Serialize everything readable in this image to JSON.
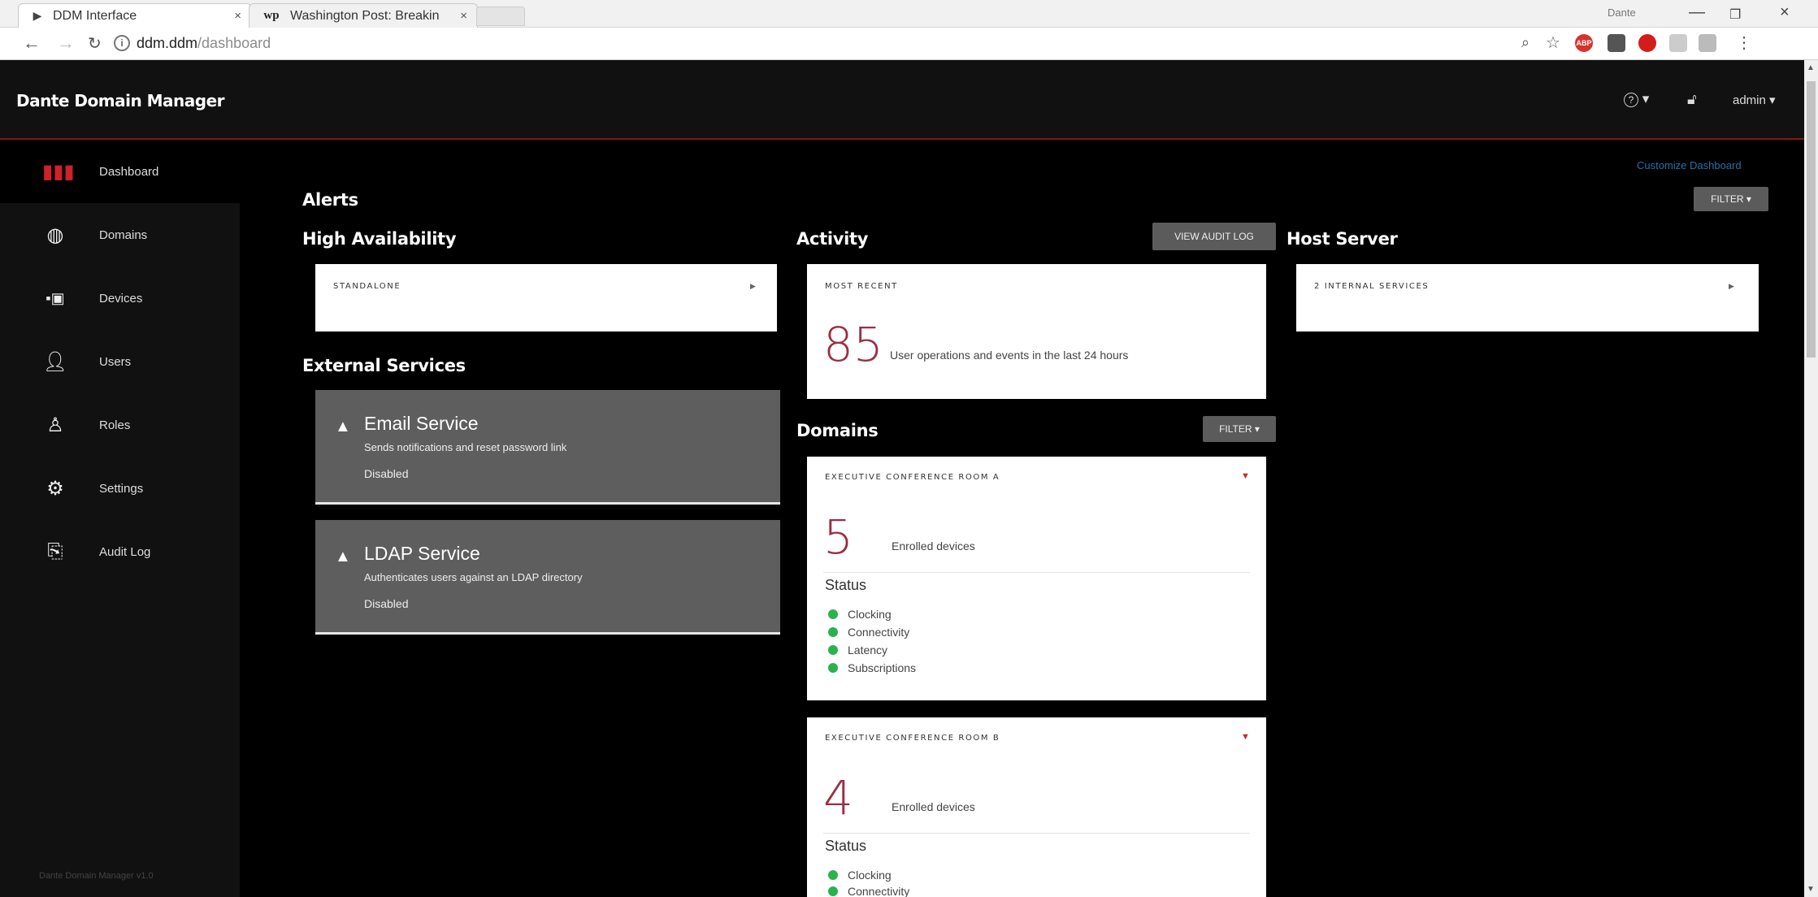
{
  "browser": {
    "tabs": [
      {
        "title": "DDM Interface",
        "favicon": "play-icon"
      },
      {
        "title": "Washington Post: Breakin",
        "favicon": "wp"
      }
    ],
    "profile": "Dante",
    "url_host": "ddm.ddm",
    "url_path": "/dashboard",
    "extensions": [
      "ABP"
    ]
  },
  "header": {
    "brand": "Dante Domain Manager",
    "help_label": "?",
    "user_label": "admin"
  },
  "sidebar": {
    "items": [
      {
        "label": "Dashboard",
        "icon": "bar-chart-icon"
      },
      {
        "label": "Domains",
        "icon": "globe-icon"
      },
      {
        "label": "Devices",
        "icon": "devices-icon"
      },
      {
        "label": "Users",
        "icon": "user-icon"
      },
      {
        "label": "Roles",
        "icon": "role-icon"
      },
      {
        "label": "Settings",
        "icon": "gears-icon"
      },
      {
        "label": "Audit Log",
        "icon": "audit-log-icon"
      }
    ],
    "version": "Dante Domain Manager v1.0"
  },
  "dashboard": {
    "customize_label": "Customize Dashboard",
    "filter_label": "FILTER",
    "alerts_title": "Alerts",
    "high_availability": {
      "title": "High Availability",
      "mode": "STANDALONE"
    },
    "external_services": {
      "title": "External Services",
      "services": [
        {
          "name": "Email Service",
          "description": "Sends notifications and reset password link",
          "state": "Disabled"
        },
        {
          "name": "LDAP Service",
          "description": "Authenticates users against an LDAP directory",
          "state": "Disabled"
        }
      ]
    },
    "activity": {
      "title": "Activity",
      "audit_button": "VIEW AUDIT LOG",
      "caption": "MOST RECENT",
      "count": "85",
      "text": "User operations and events in the last 24 hours"
    },
    "host_server": {
      "title": "Host Server",
      "caption": "2 INTERNAL SERVICES"
    },
    "domains": {
      "title": "Domains",
      "filter_label": "FILTER",
      "status_label": "Status",
      "enrolled_label": "Enrolled devices",
      "cards": [
        {
          "name": "EXECUTIVE CONFERENCE ROOM A",
          "count": "5",
          "statuses": [
            "Clocking",
            "Connectivity",
            "Latency",
            "Subscriptions"
          ]
        },
        {
          "name": "EXECUTIVE CONFERENCE ROOM B",
          "count": "4",
          "statuses": [
            "Clocking",
            "Connectivity"
          ]
        }
      ]
    }
  },
  "colors": {
    "accent": "#d0202a",
    "number": "#9b2d45",
    "status_ok": "#2bb24c",
    "link": "#2b6ea8"
  }
}
